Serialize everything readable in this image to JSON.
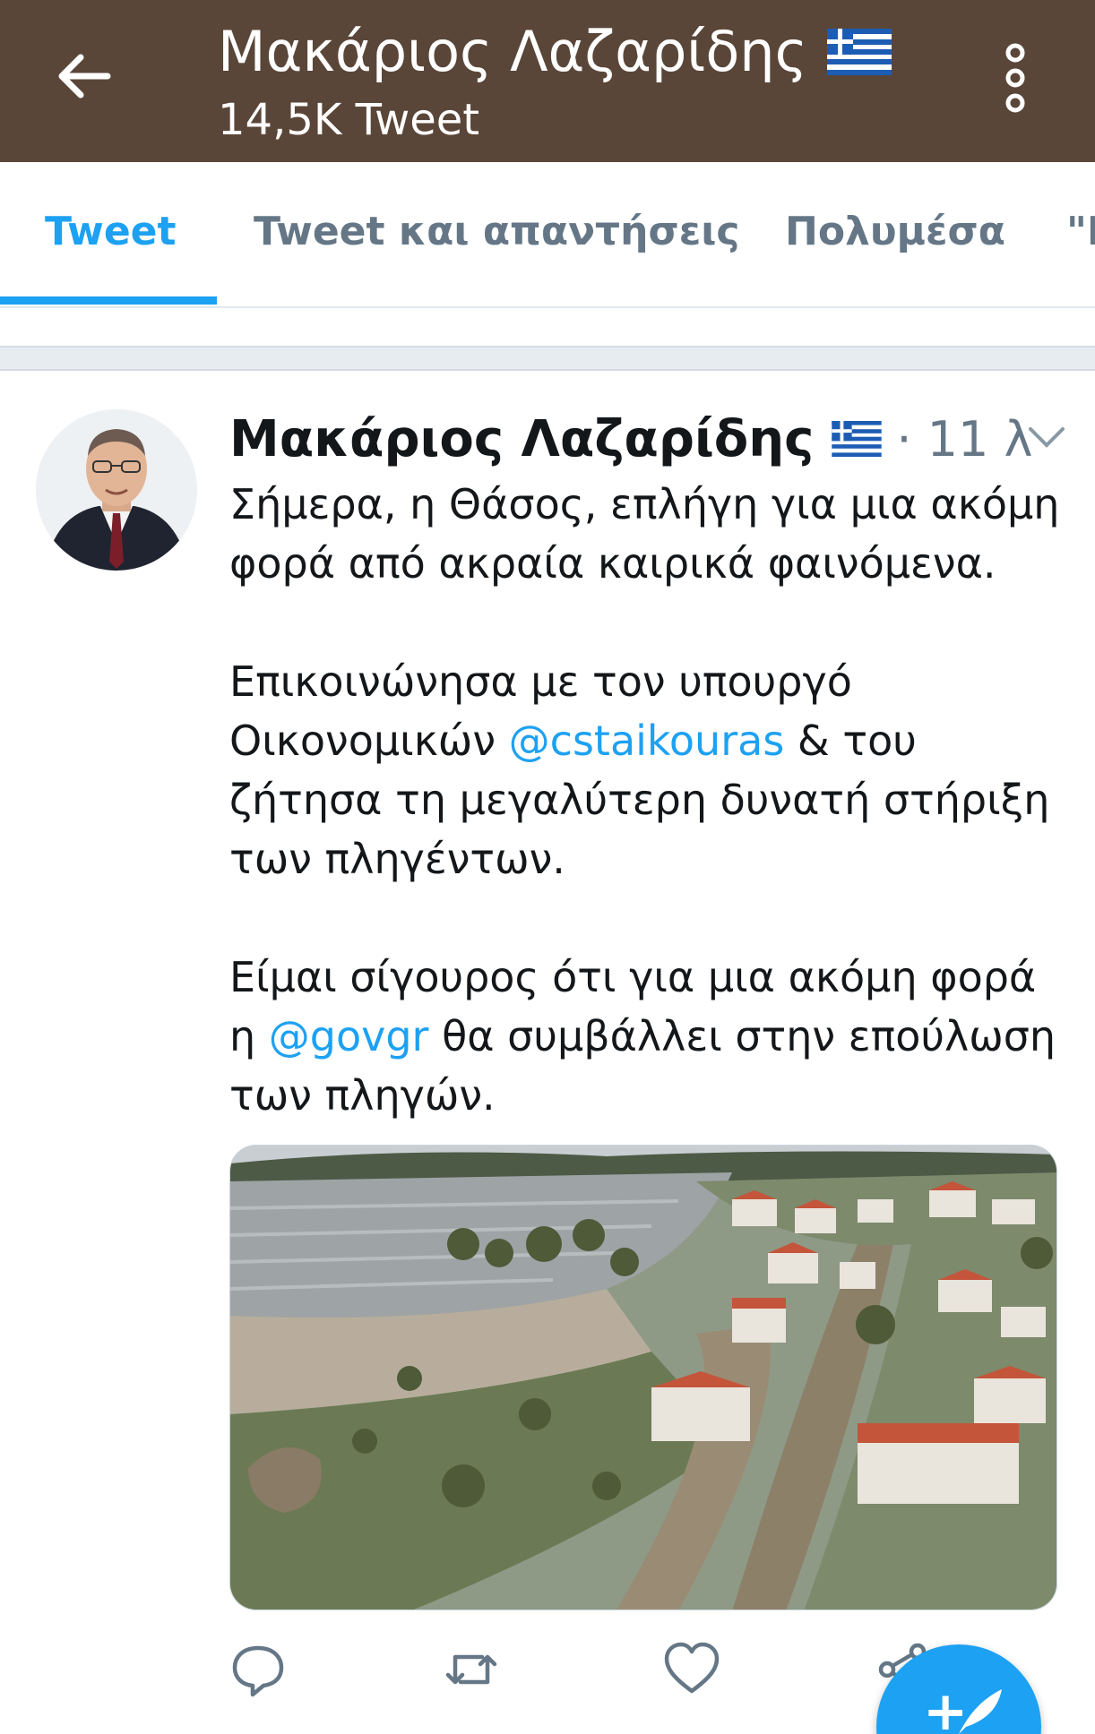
{
  "header": {
    "title": "Μακάριος Λαζαρίδης",
    "subtitle": "14,5K Tweet",
    "background_color": "#5a4638",
    "back_icon": "arrow-left-icon",
    "more_icon": "more-vertical-icon",
    "flag_icon": "greek-flag-icon"
  },
  "tabs": [
    {
      "label": "Tweet",
      "active": true
    },
    {
      "label": "Tweet και απαντήσεις",
      "active": false
    },
    {
      "label": "Πολυμέσα",
      "active": false
    },
    {
      "label": "\"Μ",
      "active": false
    }
  ],
  "tweet": {
    "author": "Μακάριος Λαζαρίδης",
    "time": "· 11 λ",
    "paragraph1": "Σήμερα, η Θάσος, επλήγη για μια ακόμη φορά από ακραία καιρικά φαινόμενα.",
    "paragraph2": {
      "before": "Επικοινώνησα με τον υπουργό Οικονομικών ",
      "mention": "@cstaikouras",
      "after": " & του ζήτησα τη μεγαλύτερη δυνατή στήριξη των πληγέντων."
    },
    "paragraph3": {
      "before": "Είμαι σίγουρος ότι για μια ακόμη φορά η ",
      "mention": "@govgr",
      "after": " θα συμβάλλει στην επούλωση των πληγών."
    },
    "photo_description_icon": "aerial-photo-flooded-village",
    "action_icons": [
      "reply-icon",
      "retweet-icon",
      "like-icon",
      "share-icon"
    ]
  },
  "fab": {
    "glyph": "+",
    "icon": "compose-tweet-icon"
  },
  "colors": {
    "accent": "#1da1f2",
    "text": "#14171a",
    "muted": "#657786"
  }
}
